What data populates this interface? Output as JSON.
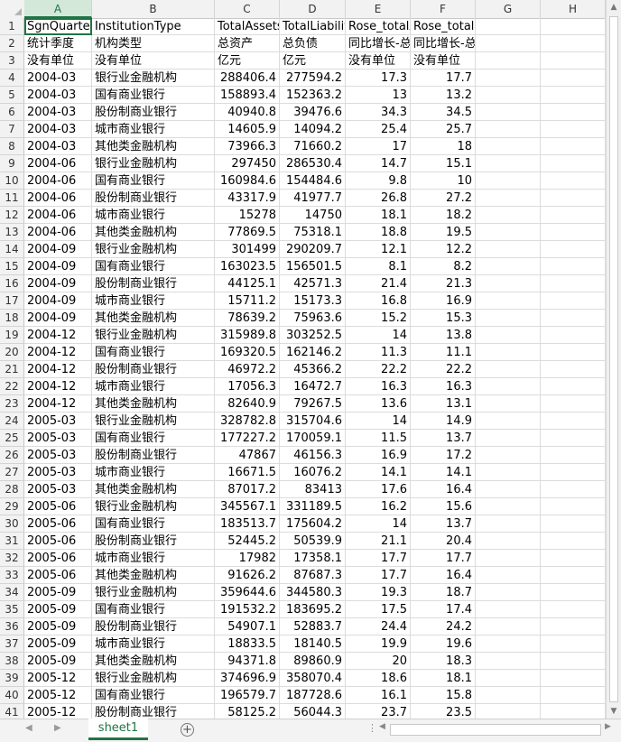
{
  "columns": [
    "A",
    "B",
    "C",
    "D",
    "E",
    "F",
    "G",
    "H"
  ],
  "selected_column": "A",
  "rows": [
    [
      "SgnQuarter",
      "InstitutionType",
      "TotalAssets",
      "TotalLiabilities",
      "Rose_totalAssets",
      "Rose_totalLiabilities",
      "",
      ""
    ],
    [
      "统计季度",
      "机构类型",
      "总资产",
      "总负债",
      "同比增长-总资产(%)",
      "同比增长-总负债(%)",
      "",
      ""
    ],
    [
      "没有单位",
      "没有单位",
      "亿元",
      "亿元",
      "没有单位",
      "没有单位",
      "",
      ""
    ],
    [
      "2004-03",
      "银行业金融机构",
      "288406.4",
      "277594.2",
      "17.3",
      "17.7",
      "",
      ""
    ],
    [
      "2004-03",
      "国有商业银行",
      "158893.4",
      "152363.2",
      "13",
      "13.2",
      "",
      ""
    ],
    [
      "2004-03",
      "股份制商业银行",
      "40940.8",
      "39476.6",
      "34.3",
      "34.5",
      "",
      ""
    ],
    [
      "2004-03",
      "城市商业银行",
      "14605.9",
      "14094.2",
      "25.4",
      "25.7",
      "",
      ""
    ],
    [
      "2004-03",
      "其他类金融机构",
      "73966.3",
      "71660.2",
      "17",
      "18",
      "",
      ""
    ],
    [
      "2004-06",
      "银行业金融机构",
      "297450",
      "286530.4",
      "14.7",
      "15.1",
      "",
      ""
    ],
    [
      "2004-06",
      "国有商业银行",
      "160984.6",
      "154484.6",
      "9.8",
      "10",
      "",
      ""
    ],
    [
      "2004-06",
      "股份制商业银行",
      "43317.9",
      "41977.7",
      "26.8",
      "27.2",
      "",
      ""
    ],
    [
      "2004-06",
      "城市商业银行",
      "15278",
      "14750",
      "18.1",
      "18.2",
      "",
      ""
    ],
    [
      "2004-06",
      "其他类金融机构",
      "77869.5",
      "75318.1",
      "18.8",
      "19.5",
      "",
      ""
    ],
    [
      "2004-09",
      "银行业金融机构",
      "301499",
      "290209.7",
      "12.1",
      "12.2",
      "",
      ""
    ],
    [
      "2004-09",
      "国有商业银行",
      "163023.5",
      "156501.5",
      "8.1",
      "8.2",
      "",
      ""
    ],
    [
      "2004-09",
      "股份制商业银行",
      "44125.1",
      "42571.3",
      "21.4",
      "21.3",
      "",
      ""
    ],
    [
      "2004-09",
      "城市商业银行",
      "15711.2",
      "15173.3",
      "16.8",
      "16.9",
      "",
      ""
    ],
    [
      "2004-09",
      "其他类金融机构",
      "78639.2",
      "75963.6",
      "15.2",
      "15.3",
      "",
      ""
    ],
    [
      "2004-12",
      "银行业金融机构",
      "315989.8",
      "303252.5",
      "14",
      "13.8",
      "",
      ""
    ],
    [
      "2004-12",
      "国有商业银行",
      "169320.5",
      "162146.2",
      "11.3",
      "11.1",
      "",
      ""
    ],
    [
      "2004-12",
      "股份制商业银行",
      "46972.2",
      "45366.2",
      "22.2",
      "22.2",
      "",
      ""
    ],
    [
      "2004-12",
      "城市商业银行",
      "17056.3",
      "16472.7",
      "16.3",
      "16.3",
      "",
      ""
    ],
    [
      "2004-12",
      "其他类金融机构",
      "82640.9",
      "79267.5",
      "13.6",
      "13.1",
      "",
      ""
    ],
    [
      "2005-03",
      "银行业金融机构",
      "328782.8",
      "315704.6",
      "14",
      "14.9",
      "",
      ""
    ],
    [
      "2005-03",
      "国有商业银行",
      "177227.2",
      "170059.1",
      "11.5",
      "13.7",
      "",
      ""
    ],
    [
      "2005-03",
      "股份制商业银行",
      "47867",
      "46156.3",
      "16.9",
      "17.2",
      "",
      ""
    ],
    [
      "2005-03",
      "城市商业银行",
      "16671.5",
      "16076.2",
      "14.1",
      "14.1",
      "",
      ""
    ],
    [
      "2005-03",
      "其他类金融机构",
      "87017.2",
      "83413",
      "17.6",
      "16.4",
      "",
      ""
    ],
    [
      "2005-06",
      "银行业金融机构",
      "345567.1",
      "331189.5",
      "16.2",
      "15.6",
      "",
      ""
    ],
    [
      "2005-06",
      "国有商业银行",
      "183513.7",
      "175604.2",
      "14",
      "13.7",
      "",
      ""
    ],
    [
      "2005-06",
      "股份制商业银行",
      "52445.2",
      "50539.9",
      "21.1",
      "20.4",
      "",
      ""
    ],
    [
      "2005-06",
      "城市商业银行",
      "17982",
      "17358.1",
      "17.7",
      "17.7",
      "",
      ""
    ],
    [
      "2005-06",
      "其他类金融机构",
      "91626.2",
      "87687.3",
      "17.7",
      "16.4",
      "",
      ""
    ],
    [
      "2005-09",
      "银行业金融机构",
      "359644.6",
      "344580.3",
      "19.3",
      "18.7",
      "",
      ""
    ],
    [
      "2005-09",
      "国有商业银行",
      "191532.2",
      "183695.2",
      "17.5",
      "17.4",
      "",
      ""
    ],
    [
      "2005-09",
      "股份制商业银行",
      "54907.1",
      "52883.7",
      "24.4",
      "24.2",
      "",
      ""
    ],
    [
      "2005-09",
      "城市商业银行",
      "18833.5",
      "18140.5",
      "19.9",
      "19.6",
      "",
      ""
    ],
    [
      "2005-09",
      "其他类金融机构",
      "94371.8",
      "89860.9",
      "20",
      "18.3",
      "",
      ""
    ],
    [
      "2005-12",
      "银行业金融机构",
      "374696.9",
      "358070.4",
      "18.6",
      "18.1",
      "",
      ""
    ],
    [
      "2005-12",
      "国有商业银行",
      "196579.7",
      "187728.6",
      "16.1",
      "15.8",
      "",
      ""
    ],
    [
      "2005-12",
      "股份制商业银行",
      "58125.2",
      "56044.3",
      "23.7",
      "23.5",
      "",
      ""
    ]
  ],
  "numeric_from_row": 4,
  "numeric_columns": [
    2,
    3,
    4,
    5
  ],
  "active_cell": "A1",
  "sheet_tab": "sheet1",
  "add_sheet_symbol": "+",
  "colors": {
    "accent": "#217346",
    "selected_header_bg": "#d3e8d9"
  },
  "icons": {
    "nav_prev": "nav-prev-icon",
    "nav_next": "nav-next-icon",
    "add_sheet": "add-sheet-icon"
  }
}
